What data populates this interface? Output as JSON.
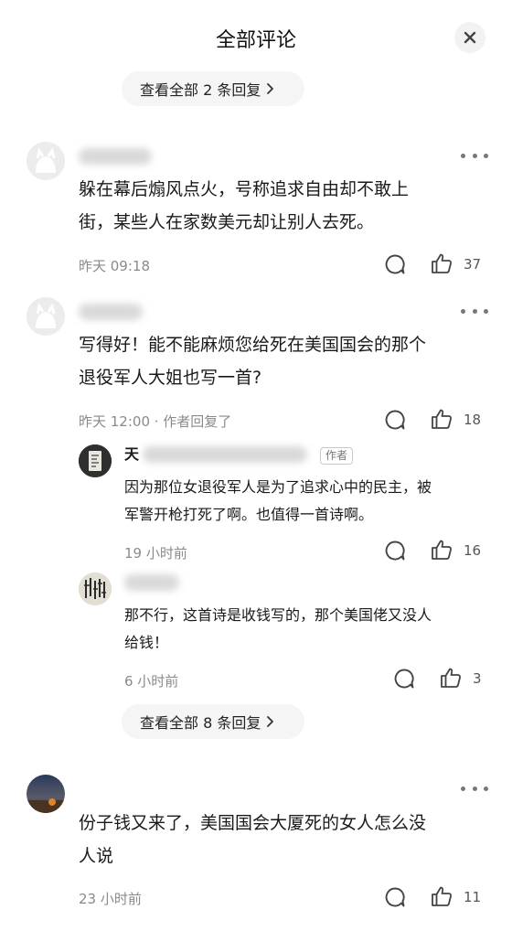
{
  "header": {
    "title": "全部评论"
  },
  "top_expand": {
    "label": "查看全部 2 条回复"
  },
  "comments": [
    {
      "text_line1": "躲在幕后煽风点火，号称追求自由却不敢上",
      "text_line2": "街，某些人在家数美元却让别人去死。",
      "time": "昨天 09:18",
      "likes": "37"
    },
    {
      "text_line1": "写得好！能不能麻烦您给死在美国国会的那个",
      "text_line2": "退役军人大姐也写一首?",
      "time": "昨天 12:00 · 作者回复了",
      "likes": "18",
      "replies": [
        {
          "name_visible": "天",
          "badge": "作者",
          "text_line1": "因为那位女退役军人是为了追求心中的民主，被",
          "text_line2": "军警开枪打死了啊。也值得一首诗啊。",
          "time": "19 小时前",
          "likes": "16"
        },
        {
          "text_line1": "那不行，这首诗是收钱写的，那个美国佬又没人",
          "text_line2": "给钱！",
          "time": "6 小时前",
          "likes": "3"
        }
      ],
      "expand_label": "查看全部 8 条回复"
    },
    {
      "text_line1": "份子钱又来了，美国国会大厦死的女人怎么没",
      "text_line2": "人说",
      "time": "23 小时前",
      "likes": "11"
    }
  ],
  "icons": [
    "close-icon",
    "chevron-right-icon",
    "more-icon",
    "reply-bubble-icon",
    "thumbs-up-icon"
  ]
}
